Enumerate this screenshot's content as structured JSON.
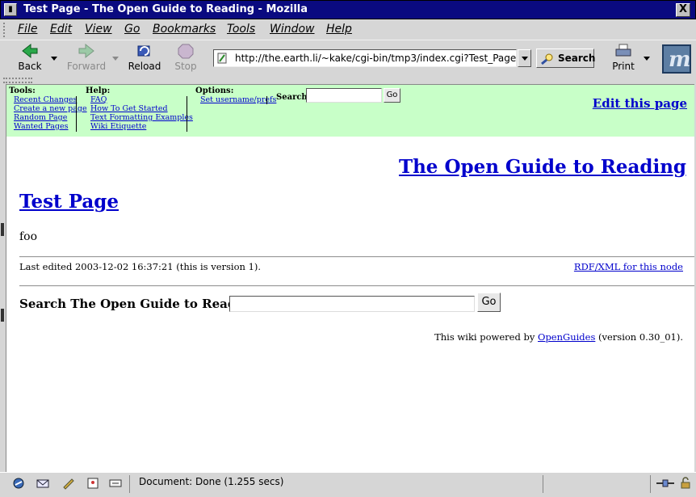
{
  "window": {
    "title": "Test Page - The Open Guide to Reading - Mozilla",
    "close_glyph": "X"
  },
  "menubar": {
    "items": [
      {
        "label": "File"
      },
      {
        "label": "Edit"
      },
      {
        "label": "View"
      },
      {
        "label": "Go"
      },
      {
        "label": "Bookmarks"
      },
      {
        "label": "Tools"
      },
      {
        "label": "Window"
      },
      {
        "label": "Help"
      }
    ]
  },
  "toolbar": {
    "back_label": "Back",
    "forward_label": "Forward",
    "reload_label": "Reload",
    "stop_label": "Stop",
    "url": "http://the.earth.li/~kake/cgi-bin/tmp3/index.cgi?Test_Page",
    "search_label": "Search",
    "print_label": "Print",
    "brand_glyph": "m"
  },
  "wiki_nav": {
    "tools": {
      "heading": "Tools:",
      "links": [
        "Recent Changes",
        "Create a new page",
        "Random Page",
        "Wanted Pages"
      ]
    },
    "help": {
      "heading": "Help:",
      "links": [
        "FAQ",
        "How To Get Started",
        "Text Formatting Examples",
        "Wiki Etiquette"
      ]
    },
    "options": {
      "heading": "Options:",
      "links": [
        "Set username/prefs"
      ]
    },
    "search_label": "Search:",
    "search_value": "",
    "go_label": "Go",
    "edit_link": "Edit this page"
  },
  "page": {
    "site_title": "The Open Guide to Reading",
    "heading": "Test Page",
    "body": "foo",
    "last_edited": "Last edited 2003-12-02 16:37:21 (this is version 1).",
    "rdf_link": "RDF/XML for this node",
    "bottom_search_label": "Search The Open Guide to Reading:",
    "bottom_search_value": "",
    "bottom_go_label": "Go",
    "powered_prefix": "This wiki powered by",
    "powered_link": "OpenGuides",
    "powered_suffix": "(version 0.30_01)."
  },
  "statusbar": {
    "text": "Document: Done (1.255 secs)",
    "icons": [
      "navigator-icon",
      "mail-icon",
      "composer-icon",
      "addressbook-icon",
      "irc-icon"
    ]
  },
  "colors": {
    "titlebar": "#0a0a80",
    "wiki_nav_bg": "#c8ffc8",
    "link": "#0000cc"
  }
}
